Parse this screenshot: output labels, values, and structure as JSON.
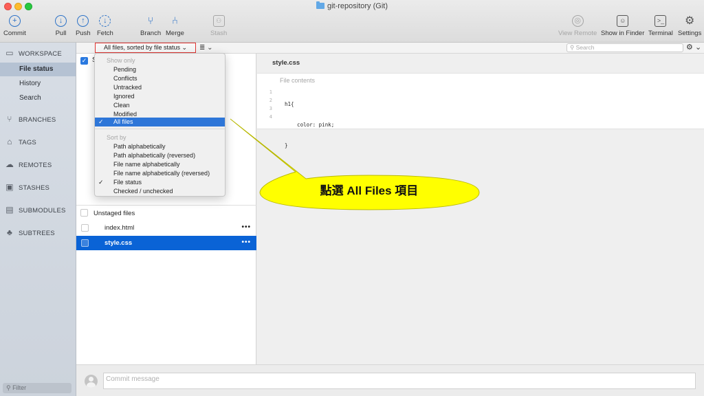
{
  "window": {
    "title": "git-repository (Git)"
  },
  "toolbar": {
    "commit": "Commit",
    "pull": "Pull",
    "push": "Push",
    "fetch": "Fetch",
    "branch": "Branch",
    "merge": "Merge",
    "stash": "Stash",
    "view_remote": "View Remote",
    "show_in_finder": "Show in Finder",
    "terminal": "Terminal",
    "settings": "Settings"
  },
  "sidebar": {
    "workspace": "WORKSPACE",
    "workspace_items": [
      "File status",
      "History",
      "Search"
    ],
    "branches": "BRANCHES",
    "tags": "TAGS",
    "remotes": "REMOTES",
    "stashes": "STASHES",
    "submodules": "SUBMODULES",
    "subtrees": "SUBTREES",
    "filter_placeholder": "Filter"
  },
  "filterbar": {
    "sort_label": "All files, sorted by file status",
    "search_placeholder": "Search"
  },
  "menu": {
    "show_only_header": "Show only",
    "show_items": [
      "Pending",
      "Conflicts",
      "Untracked",
      "Ignored",
      "Clean",
      "Modified",
      "All files"
    ],
    "sort_by_header": "Sort by",
    "sort_items": [
      "Path alphabetically",
      "Path alphabetically (reversed)",
      "File name alphabetically",
      "File name alphabetically (reversed)",
      "File status",
      "Checked / unchecked"
    ],
    "check_mark": "✓"
  },
  "files": {
    "staged_initial": "S",
    "unstaged_label": "Unstaged files",
    "rows": [
      {
        "name": "index.html",
        "more": "•••"
      },
      {
        "name": "style.css",
        "more": "•••"
      }
    ]
  },
  "diff": {
    "title": "style.css",
    "contents_label": "File contents",
    "line_numbers": [
      "1",
      "2",
      "3",
      "4"
    ],
    "lines": [
      "h1{",
      "    color: pink;",
      "}",
      ""
    ]
  },
  "commit": {
    "placeholder": "Commit message"
  },
  "callout": {
    "text": "點選 All Files 項目",
    "color": "#ffff00"
  }
}
